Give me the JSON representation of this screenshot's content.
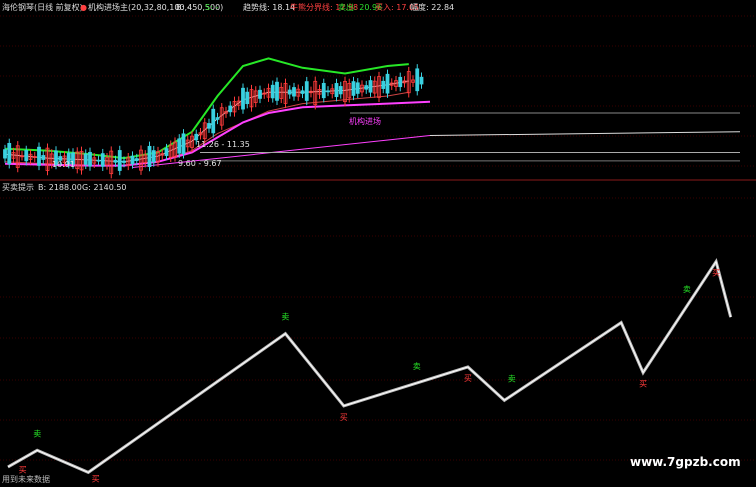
{
  "header": {
    "title": "海伦钢琴(日线 前复权)",
    "indicator_name": "机构进场主(20,32,80,100,450,500)",
    "b_label": "B: -",
    "s_label": "S: -",
    "trend_label": "趋势线: 18.14",
    "bull_bear_label": "牛熊分界线: 17.98",
    "sell_label": "卖出: 20.96",
    "buy_label": "买入: 17.05",
    "range_label": "幅度: 22.84"
  },
  "sub_header": {
    "title": "买卖提示",
    "b_value": "B: 2188.00",
    "g_value": "G: 2140.50"
  },
  "price_annotations": [
    {
      "text": "11.26 - 11.35"
    },
    {
      "text": "9.60 - 9.67"
    },
    {
      "text": "10.91"
    },
    {
      "text": "机构进场"
    }
  ],
  "watermark": "www.7gpzb.com",
  "footer": "用到未来数据",
  "colors": {
    "background": "#000000",
    "up": "#ff3b3b",
    "down": "#27e827",
    "trend": "#ff40ff",
    "cyan": "#3ad0e0",
    "white": "#dddddd",
    "divider": "#8a1a1a",
    "grid": "#3a0000"
  },
  "chart_data": [
    {
      "type": "candlestick",
      "title": "海伦钢琴(日线 前复权)",
      "note": "price series values estimated on a 0-100 bar index",
      "series": [
        {
          "name": "upper",
          "x": [
            0,
            10,
            20,
            28,
            36,
            44,
            50,
            56,
            62,
            70,
            80,
            90,
            95
          ],
          "values": [
            10.6,
            10.5,
            10.3,
            10.1,
            10.4,
            11.5,
            13.4,
            15.0,
            15.4,
            14.9,
            14.6,
            15.0,
            15.1
          ]
        },
        {
          "name": "mid",
          "x": [
            0,
            10,
            20,
            28,
            36,
            44,
            50,
            56,
            62,
            70,
            80,
            90,
            95
          ],
          "values": [
            10.3,
            10.1,
            10.0,
            9.9,
            10.2,
            11.0,
            12.2,
            13.2,
            13.6,
            13.6,
            13.7,
            14.0,
            14.2
          ]
        },
        {
          "name": "lower",
          "x": [
            0,
            10,
            20,
            28,
            36,
            44,
            50,
            56,
            62,
            70,
            80,
            90,
            95
          ],
          "values": [
            9.9,
            9.8,
            9.7,
            9.7,
            9.9,
            10.5,
            11.4,
            12.0,
            12.6,
            13.0,
            13.2,
            13.4,
            13.6
          ]
        },
        {
          "name": "trend",
          "x": [
            0,
            10,
            20,
            28,
            36,
            44,
            50,
            56,
            62,
            70,
            80,
            90,
            100
          ],
          "values": [
            9.8,
            9.75,
            9.7,
            9.7,
            9.9,
            10.4,
            11.2,
            12.0,
            12.5,
            12.8,
            12.9,
            13.0,
            13.1
          ]
        },
        {
          "name": "long",
          "x": [
            30,
            100
          ],
          "values": [
            9.6,
            11.3
          ]
        }
      ]
    },
    {
      "type": "line",
      "title": "买卖提示",
      "x": [
        0,
        4,
        11,
        38,
        46,
        63,
        68,
        84,
        87,
        97,
        99
      ],
      "values": [
        2148,
        2151,
        2147,
        2172,
        2159,
        2166,
        2160,
        2174,
        2165,
        2185,
        2175
      ],
      "signals": [
        {
          "x": 2,
          "label": "买"
        },
        {
          "x": 4,
          "label": "卖"
        },
        {
          "x": 12,
          "label": "买"
        },
        {
          "x": 38,
          "label": "卖"
        },
        {
          "x": 46,
          "label": "买"
        },
        {
          "x": 56,
          "label": "卖"
        },
        {
          "x": 63,
          "label": "买"
        },
        {
          "x": 69,
          "label": "卖"
        },
        {
          "x": 87,
          "label": "买"
        },
        {
          "x": 93,
          "label": "卖"
        },
        {
          "x": 97,
          "label": "买"
        }
      ]
    }
  ]
}
